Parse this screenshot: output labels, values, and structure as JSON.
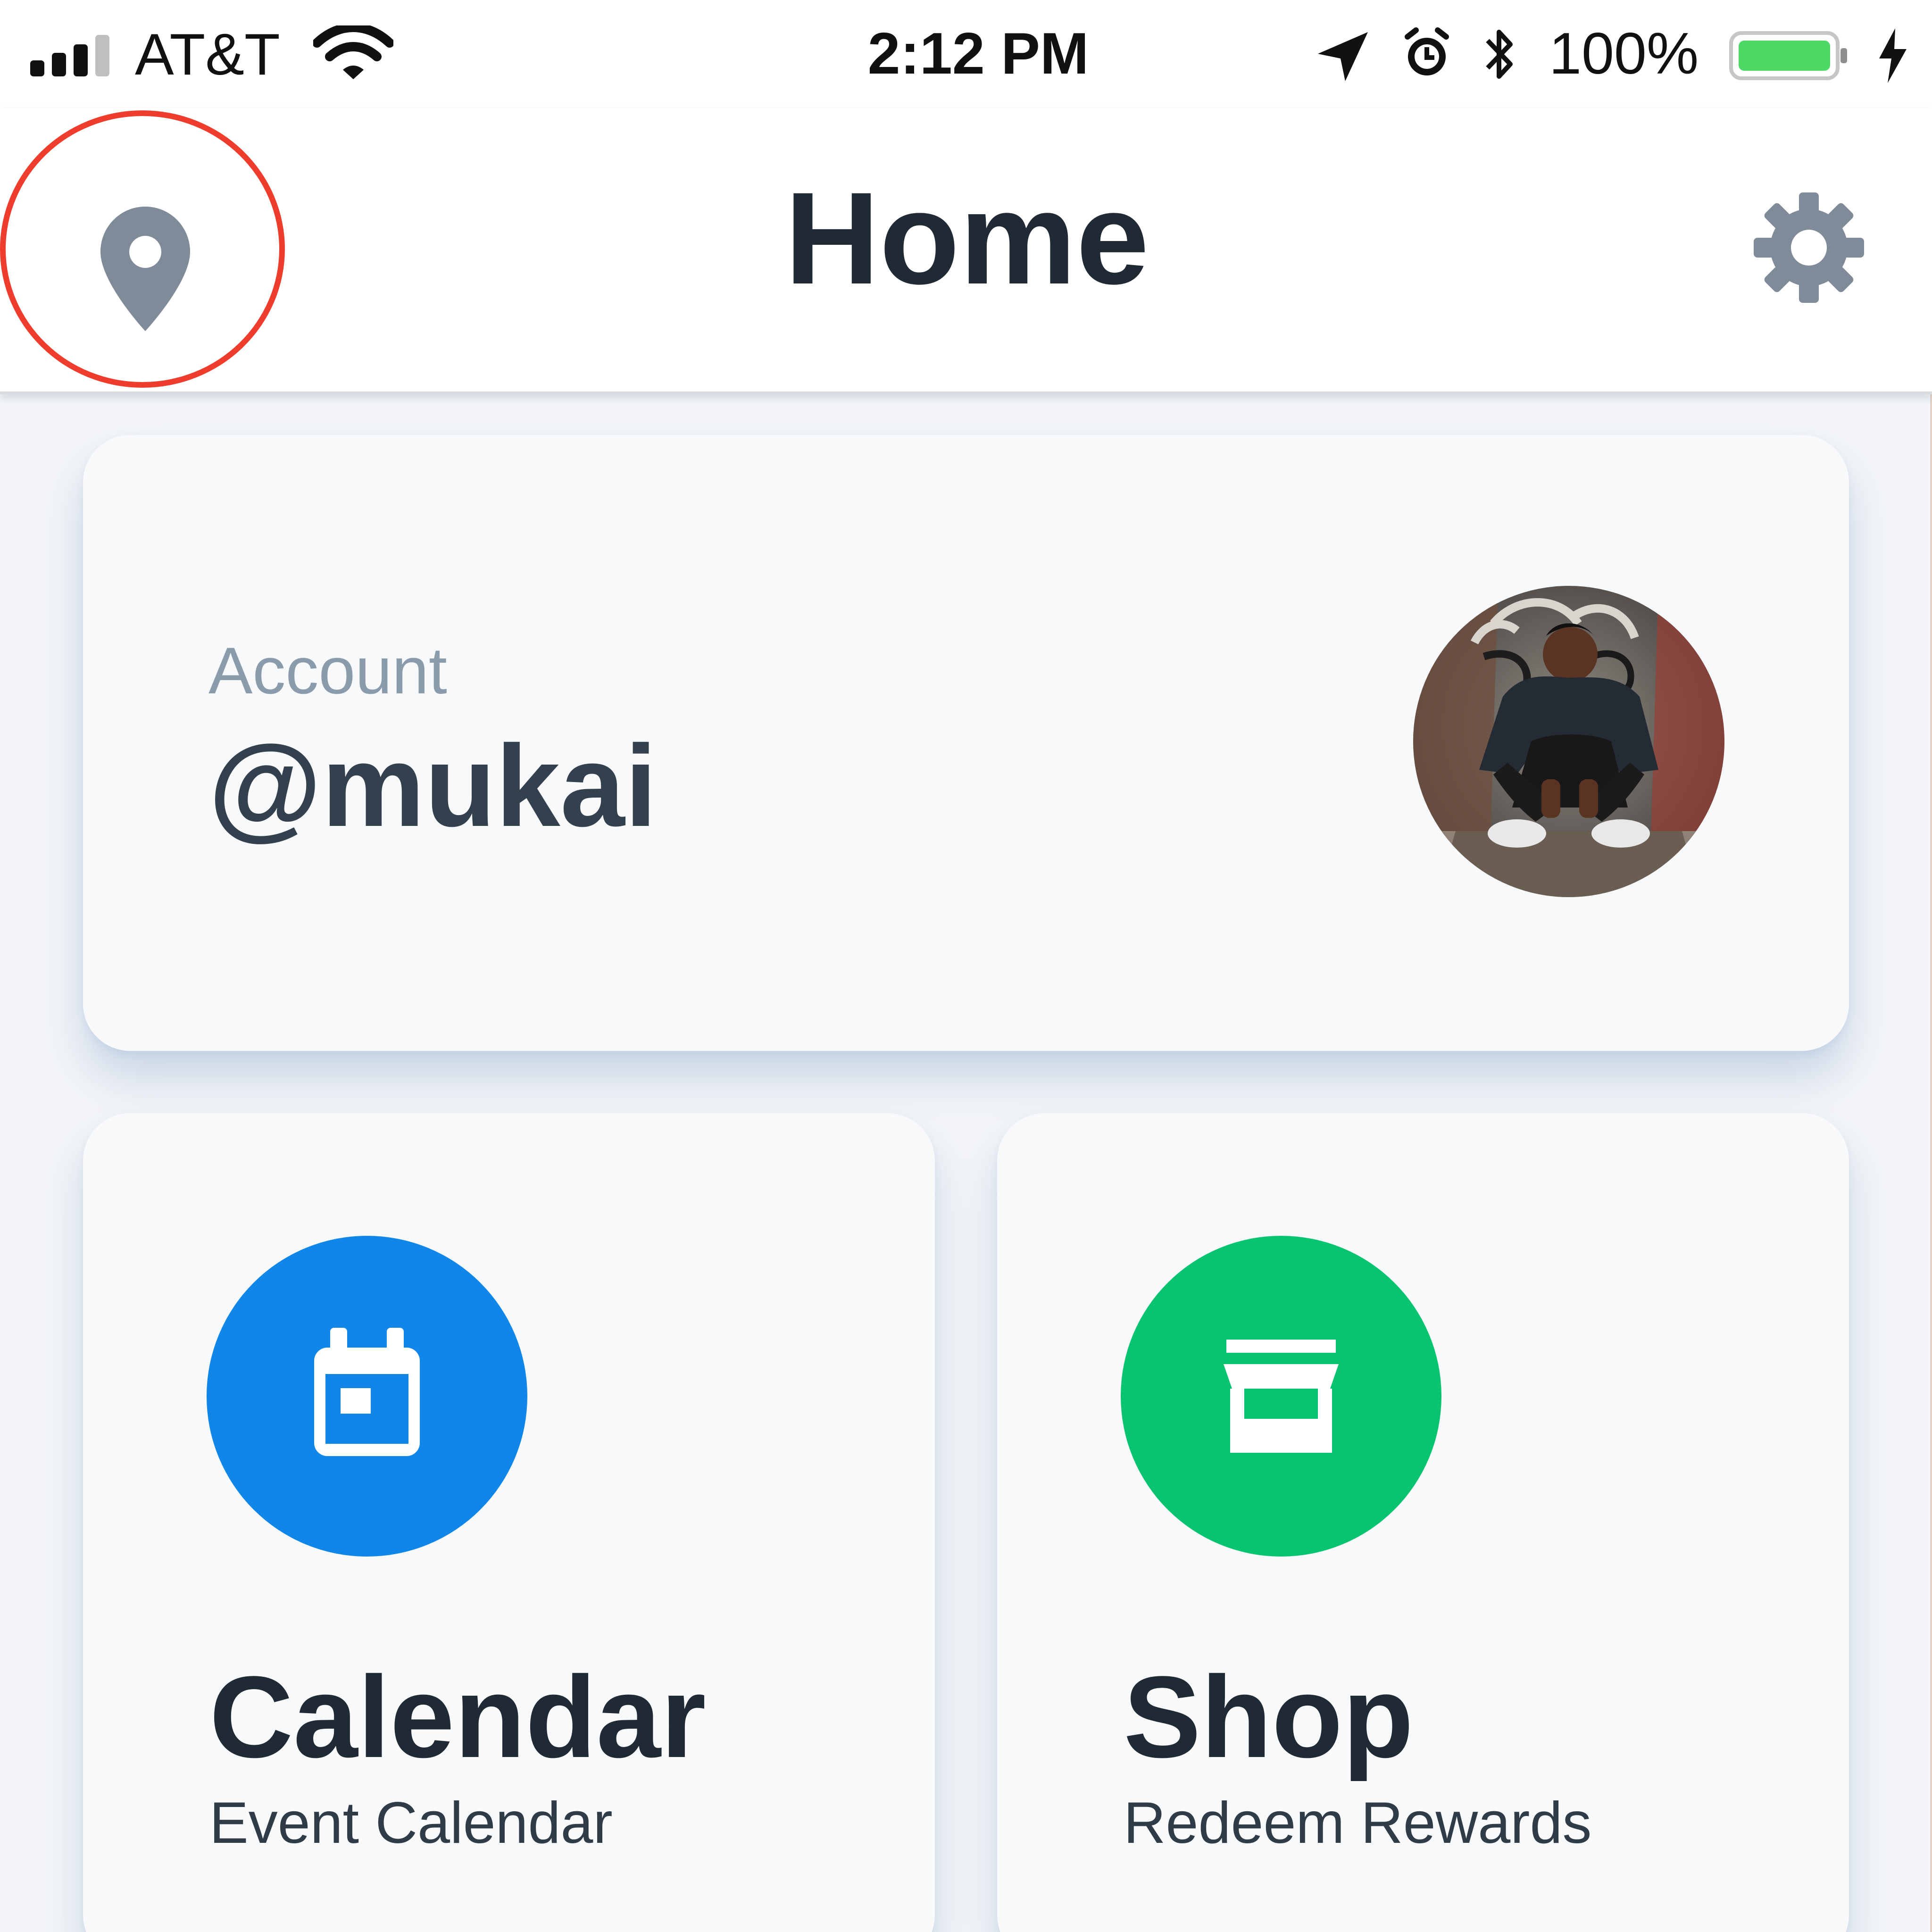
{
  "status_bar": {
    "carrier": "AT&T",
    "time": "2:12 PM",
    "battery_percent": "100%",
    "battery_level": 1.0,
    "icons": [
      "signal-icon",
      "wifi-icon",
      "location-arrow-icon",
      "alarm-icon",
      "bluetooth-icon",
      "battery-icon",
      "charging-icon"
    ]
  },
  "header": {
    "title": "Home",
    "left_icon": "location-pin-icon",
    "right_icon": "gear-icon"
  },
  "account": {
    "label": "Account",
    "handle": "@mukai"
  },
  "tiles": [
    {
      "title": "Calendar",
      "subtitle": "Event Calendar",
      "icon": "calendar-icon",
      "color": "#0f86e8"
    },
    {
      "title": "Shop",
      "subtitle": "Redeem Rewards",
      "icon": "storefront-icon",
      "color": "#08c470"
    }
  ],
  "colors": {
    "highlight": "#ef3d2d",
    "icon_gray": "#7f8b99",
    "battery_green": "#4cd964",
    "text_dark": "#1f2a35"
  }
}
